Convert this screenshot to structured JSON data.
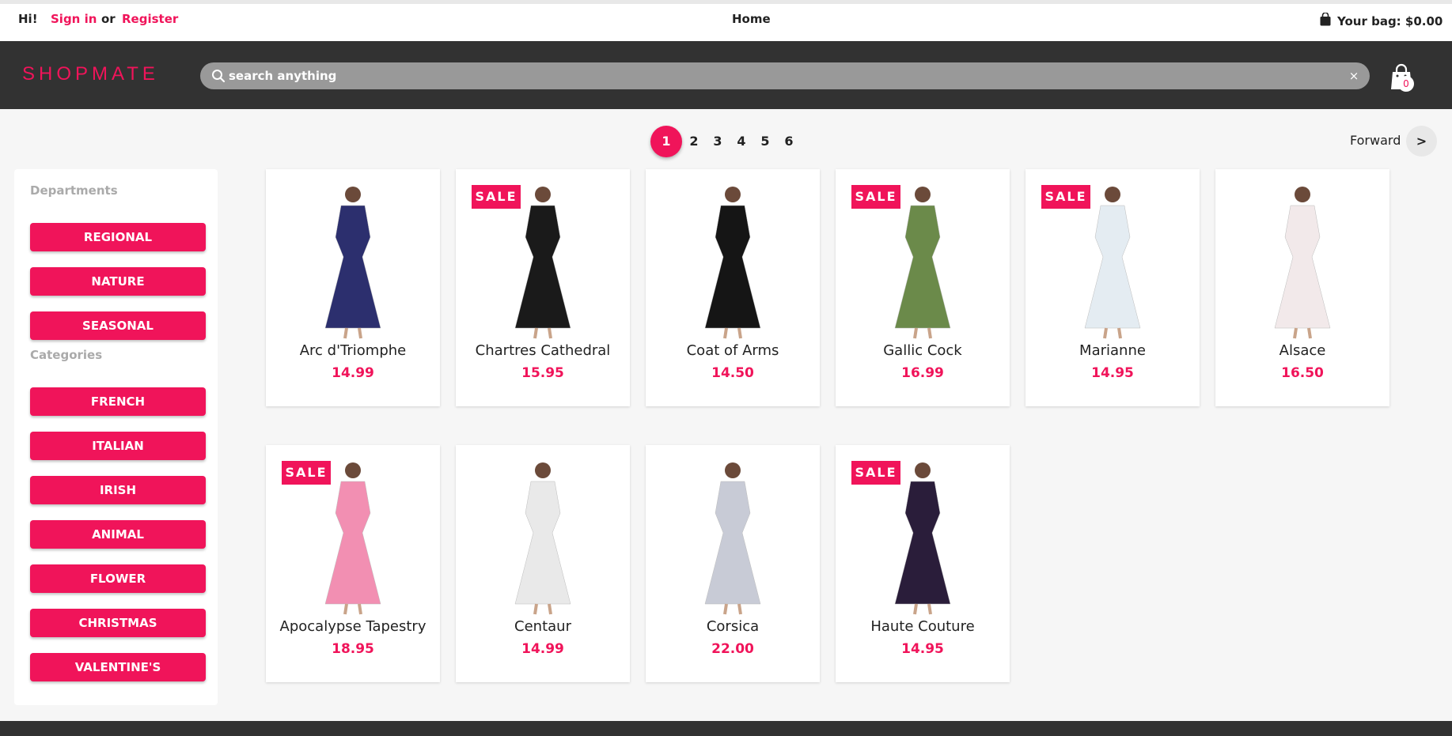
{
  "topbar": {
    "greeting": "Hi!",
    "sign_in": "Sign in",
    "or": "or",
    "register": "Register",
    "home": "Home",
    "bag_text": "Your bag: $0.00"
  },
  "header": {
    "logo": "SHOPMATE",
    "search_placeholder": "search anything",
    "clear": "×",
    "cart_count": "0"
  },
  "pagination": {
    "pages": [
      "1",
      "2",
      "3",
      "4",
      "5",
      "6"
    ],
    "active_page": "1",
    "forward_label": "Forward",
    "forward_arrow": ">"
  },
  "sidebar": {
    "departments_heading": "Departments",
    "departments": [
      "REGIONAL",
      "NATURE",
      "SEASONAL"
    ],
    "categories_heading": "Categories",
    "categories": [
      "FRENCH",
      "ITALIAN",
      "IRISH",
      "ANIMAL",
      "FLOWER",
      "CHRISTMAS",
      "VALENTINE'S"
    ]
  },
  "sale_label": "SALE",
  "products": [
    {
      "name": "Arc d'Triomphe",
      "price": "14.99",
      "sale": false,
      "color": "#2c2f6e"
    },
    {
      "name": "Chartres Cathedral",
      "price": "15.95",
      "sale": true,
      "color": "#1a1a1a"
    },
    {
      "name": "Coat of Arms",
      "price": "14.50",
      "sale": false,
      "color": "#151515"
    },
    {
      "name": "Gallic Cock",
      "price": "16.99",
      "sale": true,
      "color": "#6b8a4a"
    },
    {
      "name": "Marianne",
      "price": "14.95",
      "sale": true,
      "color": "#e4ecf2"
    },
    {
      "name": "Alsace",
      "price": "16.50",
      "sale": false,
      "color": "#f2e9ea"
    },
    {
      "name": "Apocalypse Tapestry",
      "price": "18.95",
      "sale": true,
      "color": "#f28fb2"
    },
    {
      "name": "Centaur",
      "price": "14.99",
      "sale": false,
      "color": "#e9e9e9"
    },
    {
      "name": "Corsica",
      "price": "22.00",
      "sale": false,
      "color": "#c8cbd6"
    },
    {
      "name": "Haute Couture",
      "price": "14.95",
      "sale": true,
      "color": "#2a1d3a"
    }
  ]
}
